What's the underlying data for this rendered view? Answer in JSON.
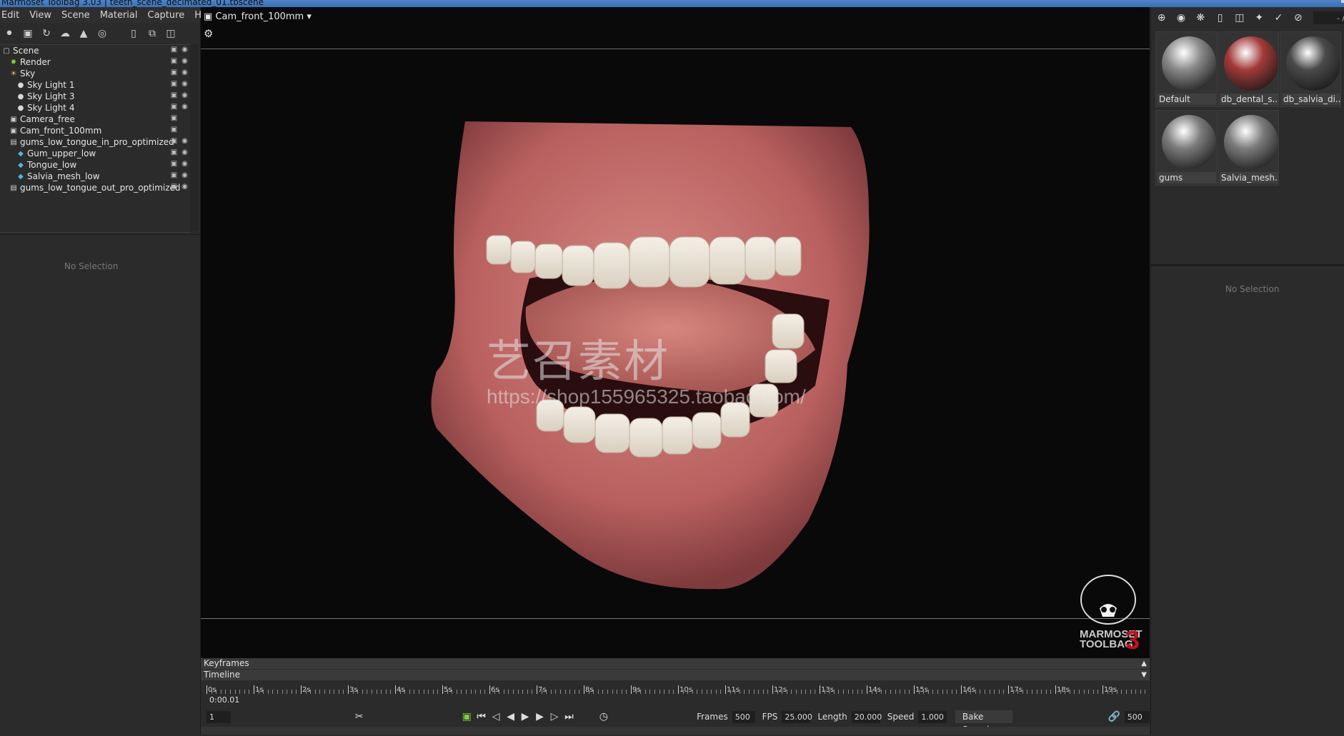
{
  "window": {
    "title": "Marmoset Toolbag 3.03  |  teeth_scene_decimated_01.tbscene"
  },
  "menu": [
    "Edit",
    "View",
    "Scene",
    "Material",
    "Capture",
    "Help"
  ],
  "scene_toolbar_icons": [
    "light-icon",
    "camera-icon",
    "turntable-icon",
    "fog-icon",
    "shadow-icon",
    "reflection-icon",
    "folder-icon",
    "duplicate-icon",
    "trash-icon"
  ],
  "outliner": {
    "items": [
      {
        "label": "Scene",
        "icon": "scene-icon",
        "depth": 0
      },
      {
        "label": "Render",
        "icon": "render-icon",
        "depth": 1
      },
      {
        "label": "Sky",
        "icon": "sky-icon",
        "depth": 1
      },
      {
        "label": "Sky Light 1",
        "icon": "light-icon",
        "depth": 2
      },
      {
        "label": "Sky Light 3",
        "icon": "light-icon",
        "depth": 2
      },
      {
        "label": "Sky Light 4",
        "icon": "light-icon",
        "depth": 2
      },
      {
        "label": "Camera_free",
        "icon": "camera-icon",
        "depth": 1
      },
      {
        "label": "Cam_front_100mm",
        "icon": "camera-icon",
        "depth": 1
      },
      {
        "label": "gums_low_tongue_in_pro_optimized",
        "icon": "file-icon",
        "depth": 1
      },
      {
        "label": "Gum_upper_low",
        "icon": "mesh-icon",
        "depth": 2
      },
      {
        "label": "Tongue_low",
        "icon": "mesh-icon",
        "depth": 2
      },
      {
        "label": "Salvia_mesh_low",
        "icon": "mesh-icon",
        "depth": 2
      },
      {
        "label": "gums_low_tongue_out_pro_optimized",
        "icon": "file-icon",
        "depth": 1
      }
    ]
  },
  "properties": {
    "empty_text": "No Selection"
  },
  "viewport": {
    "camera": "Cam_front_100mm",
    "watermark": "艺召素材",
    "watermark_url": "https://shop155965325.taobao.com/",
    "logo_text": [
      "MARMOSET",
      "TOOLBAG"
    ],
    "logo_number": "3"
  },
  "materials": {
    "items": [
      {
        "name": "Default",
        "color": "#8a8a8a"
      },
      {
        "name": "db_dental_s...",
        "color": "#a33a3a"
      },
      {
        "name": "db_salvia_di...",
        "color": "#4a4a4a"
      },
      {
        "name": "gums",
        "color": "#7c7c7c"
      },
      {
        "name": "Salvia_mesh...",
        "color": "#7c7c7c"
      }
    ],
    "empty_text": "No Selection",
    "toolbar_readout": "- /"
  },
  "timeline": {
    "keyframes_label": "Keyframes",
    "timeline_label": "Timeline",
    "ticks": [
      "0s",
      "1s",
      "2s",
      "3s",
      "4s",
      "5s",
      "6s",
      "7s",
      "8s",
      "9s",
      "10s",
      "11s",
      "12s",
      "13s",
      "14s",
      "15s",
      "16s",
      "17s",
      "18s",
      "19s"
    ],
    "current_time": "0:00.01",
    "current_frame": "1",
    "frames_label": "Frames",
    "frames": "500",
    "fps_label": "FPS",
    "fps": "25.000",
    "length_label": "Length",
    "length": "20.000",
    "speed_label": "Speed",
    "speed": "1.000",
    "bake_speed_label": "Bake Speed",
    "end_frame": "500"
  },
  "accent_colors": {
    "selection": "#4f83c6",
    "logo_red": "#c0121a"
  }
}
